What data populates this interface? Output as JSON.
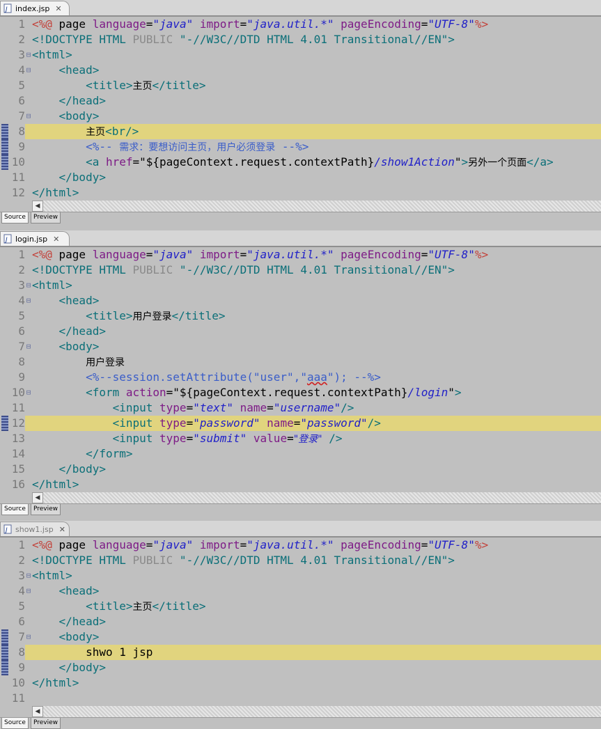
{
  "editors": [
    {
      "tab": "index.jsp",
      "active": true,
      "lines": [
        {
          "n": "1",
          "fold": "",
          "mark": false,
          "hl": false,
          "segs": [
            [
              "br",
              "<%@ "
            ],
            [
              "pl",
              "page "
            ],
            [
              "at",
              "language"
            ],
            [
              "pl",
              "="
            ],
            [
              "av",
              "\"java\""
            ],
            [
              "pl",
              " "
            ],
            [
              "at",
              "import"
            ],
            [
              "pl",
              "="
            ],
            [
              "av",
              "\"java.util.*\""
            ],
            [
              "pl",
              " "
            ],
            [
              "at",
              "pageEncoding"
            ],
            [
              "pl",
              "="
            ],
            [
              "av",
              "\"UTF-8\""
            ],
            [
              "br",
              "%>"
            ]
          ]
        },
        {
          "n": "2",
          "fold": "",
          "mark": false,
          "hl": false,
          "segs": [
            [
              "tg",
              "<!DOCTYPE HTML "
            ],
            [
              "pl",
              ""
            ],
            [
              "at2",
              "PUBLIC"
            ],
            [
              "tg",
              " \"-//W3C//DTD HTML 4.01 Transitional//EN\">"
            ]
          ]
        },
        {
          "n": "3",
          "fold": "⊖",
          "mark": false,
          "hl": false,
          "segs": [
            [
              "tg",
              "<html>"
            ]
          ]
        },
        {
          "n": "4",
          "fold": "⊖",
          "mark": false,
          "hl": false,
          "segs": [
            [
              "tg",
              "    <head>"
            ]
          ]
        },
        {
          "n": "5",
          "fold": "",
          "mark": false,
          "hl": false,
          "segs": [
            [
              "tg",
              "        <title>"
            ],
            [
              "cn",
              "主页"
            ],
            [
              "tg",
              "</title>"
            ]
          ]
        },
        {
          "n": "6",
          "fold": "",
          "mark": false,
          "hl": false,
          "segs": [
            [
              "tg",
              "    </head>"
            ]
          ]
        },
        {
          "n": "7",
          "fold": "⊖",
          "mark": false,
          "hl": false,
          "segs": [
            [
              "tg",
              "    <body>"
            ]
          ]
        },
        {
          "n": "8",
          "fold": "",
          "mark": true,
          "hl": true,
          "segs": [
            [
              "pl",
              "        "
            ],
            [
              "cn",
              "主页"
            ],
            [
              "tg",
              "<br/>"
            ]
          ]
        },
        {
          "n": "9",
          "fold": "",
          "mark": true,
          "hl": false,
          "segs": [
            [
              "cm",
              "        <%-- "
            ],
            [
              "cmcn",
              "需求：要想访问主页，用户必须登录"
            ],
            [
              "cm",
              " --%>"
            ]
          ]
        },
        {
          "n": "10",
          "fold": "",
          "mark": true,
          "hl": false,
          "segs": [
            [
              "tg",
              "        <a "
            ],
            [
              "at",
              "href"
            ],
            [
              "pl",
              "=\"${pageContext.request.contextPath}"
            ],
            [
              "av",
              "/show1Action"
            ],
            [
              "pl",
              "\""
            ],
            [
              "tg",
              ">"
            ],
            [
              "cn",
              "另外一个页面"
            ],
            [
              "tg",
              "</a>"
            ]
          ]
        },
        {
          "n": "11",
          "fold": "",
          "mark": false,
          "hl": false,
          "segs": [
            [
              "tg",
              "    </body>"
            ]
          ]
        },
        {
          "n": "12",
          "fold": "",
          "mark": false,
          "hl": false,
          "segs": [
            [
              "tg",
              "</html>"
            ]
          ]
        }
      ],
      "source_label": "Source",
      "preview_label": "Preview"
    },
    {
      "tab": "login.jsp",
      "active": true,
      "lines": [
        {
          "n": "1",
          "fold": "",
          "mark": false,
          "hl": false,
          "segs": [
            [
              "br",
              "<%@ "
            ],
            [
              "pl",
              "page "
            ],
            [
              "at",
              "language"
            ],
            [
              "pl",
              "="
            ],
            [
              "av",
              "\"java\""
            ],
            [
              "pl",
              " "
            ],
            [
              "at",
              "import"
            ],
            [
              "pl",
              "="
            ],
            [
              "av",
              "\"java.util.*\""
            ],
            [
              "pl",
              " "
            ],
            [
              "at",
              "pageEncoding"
            ],
            [
              "pl",
              "="
            ],
            [
              "av",
              "\"UTF-8\""
            ],
            [
              "br",
              "%>"
            ]
          ]
        },
        {
          "n": "2",
          "fold": "",
          "mark": false,
          "hl": false,
          "segs": [
            [
              "tg",
              "<!DOCTYPE HTML "
            ],
            [
              "at2",
              "PUBLIC"
            ],
            [
              "tg",
              " \"-//W3C//DTD HTML 4.01 Transitional//EN\">"
            ]
          ]
        },
        {
          "n": "3",
          "fold": "⊖",
          "mark": false,
          "hl": false,
          "segs": [
            [
              "tg",
              "<html>"
            ]
          ]
        },
        {
          "n": "4",
          "fold": "⊖",
          "mark": false,
          "hl": false,
          "segs": [
            [
              "tg",
              "    <head>"
            ]
          ]
        },
        {
          "n": "5",
          "fold": "",
          "mark": false,
          "hl": false,
          "segs": [
            [
              "tg",
              "        <title>"
            ],
            [
              "cn",
              "用户登录"
            ],
            [
              "tg",
              "</title>"
            ]
          ]
        },
        {
          "n": "6",
          "fold": "",
          "mark": false,
          "hl": false,
          "segs": [
            [
              "tg",
              "    </head>"
            ]
          ]
        },
        {
          "n": "7",
          "fold": "⊖",
          "mark": false,
          "hl": false,
          "segs": [
            [
              "tg",
              "    <body>"
            ]
          ]
        },
        {
          "n": "8",
          "fold": "",
          "mark": false,
          "hl": false,
          "segs": [
            [
              "pl",
              "        "
            ],
            [
              "cn",
              "用户登录"
            ]
          ]
        },
        {
          "n": "9",
          "fold": "",
          "mark": false,
          "hl": false,
          "segs": [
            [
              "cm",
              "        <%--session.setAttribute(\"user\",\""
            ],
            [
              "cmsq",
              "aaa"
            ],
            [
              "cm",
              "\"); --%>"
            ]
          ]
        },
        {
          "n": "10",
          "fold": "⊖",
          "mark": false,
          "hl": false,
          "segs": [
            [
              "tg",
              "        <form "
            ],
            [
              "at",
              "action"
            ],
            [
              "pl",
              "=\"${pageContext.request.contextPath}"
            ],
            [
              "av",
              "/login"
            ],
            [
              "pl",
              "\""
            ],
            [
              "tg",
              ">"
            ]
          ]
        },
        {
          "n": "11",
          "fold": "",
          "mark": false,
          "hl": false,
          "segs": [
            [
              "tg",
              "            <input "
            ],
            [
              "at",
              "type"
            ],
            [
              "pl",
              "="
            ],
            [
              "av",
              "\"text\""
            ],
            [
              "pl",
              " "
            ],
            [
              "at",
              "name"
            ],
            [
              "pl",
              "="
            ],
            [
              "av",
              "\"username\""
            ],
            [
              "tg",
              "/>"
            ]
          ]
        },
        {
          "n": "12",
          "fold": "",
          "mark": true,
          "hl": true,
          "segs": [
            [
              "tg",
              "            <input "
            ],
            [
              "at",
              "type"
            ],
            [
              "pl",
              "="
            ],
            [
              "av",
              "\"password\""
            ],
            [
              "pl",
              " "
            ],
            [
              "at",
              "name"
            ],
            [
              "pl",
              "="
            ],
            [
              "av",
              "\"password\""
            ],
            [
              "tg",
              "/>"
            ]
          ]
        },
        {
          "n": "13",
          "fold": "",
          "mark": false,
          "hl": false,
          "segs": [
            [
              "tg",
              "            <input "
            ],
            [
              "at",
              "type"
            ],
            [
              "pl",
              "="
            ],
            [
              "av",
              "\"submit\""
            ],
            [
              "pl",
              " "
            ],
            [
              "at",
              "value"
            ],
            [
              "pl",
              "="
            ],
            [
              "avcn",
              "\"登录\""
            ],
            [
              "tg",
              " />"
            ]
          ]
        },
        {
          "n": "14",
          "fold": "",
          "mark": false,
          "hl": false,
          "segs": [
            [
              "tg",
              "        </form>"
            ]
          ]
        },
        {
          "n": "15",
          "fold": "",
          "mark": false,
          "hl": false,
          "segs": [
            [
              "tg",
              "    </body>"
            ]
          ]
        },
        {
          "n": "16",
          "fold": "",
          "mark": false,
          "hl": false,
          "segs": [
            [
              "tg",
              "</html>"
            ]
          ]
        }
      ],
      "source_label": "Source",
      "preview_label": "Preview"
    },
    {
      "tab": "show1.jsp",
      "active": false,
      "lines": [
        {
          "n": "1",
          "fold": "",
          "mark": false,
          "hl": false,
          "segs": [
            [
              "br",
              "<%@ "
            ],
            [
              "pl",
              "page "
            ],
            [
              "at",
              "language"
            ],
            [
              "pl",
              "="
            ],
            [
              "av",
              "\"java\""
            ],
            [
              "pl",
              " "
            ],
            [
              "at",
              "import"
            ],
            [
              "pl",
              "="
            ],
            [
              "av",
              "\"java.util.*\""
            ],
            [
              "pl",
              " "
            ],
            [
              "at",
              "pageEncoding"
            ],
            [
              "pl",
              "="
            ],
            [
              "av",
              "\"UTF-8\""
            ],
            [
              "br",
              "%>"
            ]
          ]
        },
        {
          "n": "2",
          "fold": "",
          "mark": false,
          "hl": false,
          "segs": [
            [
              "tg",
              "<!DOCTYPE HTML "
            ],
            [
              "at2",
              "PUBLIC"
            ],
            [
              "tg",
              " \"-//W3C//DTD HTML 4.01 Transitional//EN\">"
            ]
          ]
        },
        {
          "n": "3",
          "fold": "⊖",
          "mark": false,
          "hl": false,
          "segs": [
            [
              "tg",
              "<html>"
            ]
          ]
        },
        {
          "n": "4",
          "fold": "⊖",
          "mark": false,
          "hl": false,
          "segs": [
            [
              "tg",
              "    <head>"
            ]
          ]
        },
        {
          "n": "5",
          "fold": "",
          "mark": false,
          "hl": false,
          "segs": [
            [
              "tg",
              "        <title>"
            ],
            [
              "cn",
              "主页"
            ],
            [
              "tg",
              "</title>"
            ]
          ]
        },
        {
          "n": "6",
          "fold": "",
          "mark": false,
          "hl": false,
          "segs": [
            [
              "tg",
              "    </head>"
            ]
          ]
        },
        {
          "n": "7",
          "fold": "⊖",
          "mark": true,
          "hl": false,
          "segs": [
            [
              "tg",
              "    <body>"
            ]
          ]
        },
        {
          "n": "8",
          "fold": "",
          "mark": true,
          "hl": true,
          "segs": [
            [
              "pl",
              "        shwo 1 jsp"
            ]
          ]
        },
        {
          "n": "9",
          "fold": "",
          "mark": true,
          "hl": false,
          "segs": [
            [
              "tg",
              "    </body>"
            ]
          ]
        },
        {
          "n": "10",
          "fold": "",
          "mark": false,
          "hl": false,
          "segs": [
            [
              "tg",
              "</html>"
            ]
          ]
        },
        {
          "n": "11",
          "fold": "",
          "mark": false,
          "hl": false,
          "segs": []
        }
      ],
      "source_label": "Source",
      "preview_label": "Preview"
    }
  ],
  "icons": {
    "file": "jsp-file-icon",
    "close": "close-icon",
    "scroll_left": "scroll-left-arrow-icon"
  },
  "colors": {
    "highlight": "#e1d47e",
    "tag": "#0b6f78",
    "attr": "#7d1b86",
    "value": "#2121c8",
    "comment": "#3a5dc9",
    "directive": "#c2413a"
  }
}
